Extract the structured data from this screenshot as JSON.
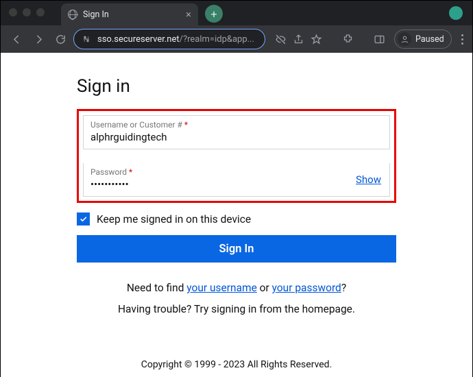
{
  "browser": {
    "tab_title": "Sign In",
    "url_host": "sso.secureserver.net",
    "url_path": "/?realm=idp&app...",
    "paused_label": "Paused"
  },
  "page": {
    "heading": "Sign in",
    "username": {
      "label": "Username or Customer #",
      "value": "alphrguidingtech"
    },
    "password": {
      "label": "Password",
      "value": "•••••••••••",
      "show_label": "Show"
    },
    "remember": {
      "label": "Keep me signed in on this device",
      "checked": true
    },
    "submit_label": "Sign In",
    "help": {
      "find_prefix": "Need to find ",
      "username_link": "your username",
      "or_text": " or ",
      "password_link": "your password",
      "q": "?",
      "trouble_text": "Having trouble? Try signing in from the homepage."
    },
    "copyright": "Copyright © 1999 - 2023 All Rights Reserved."
  }
}
